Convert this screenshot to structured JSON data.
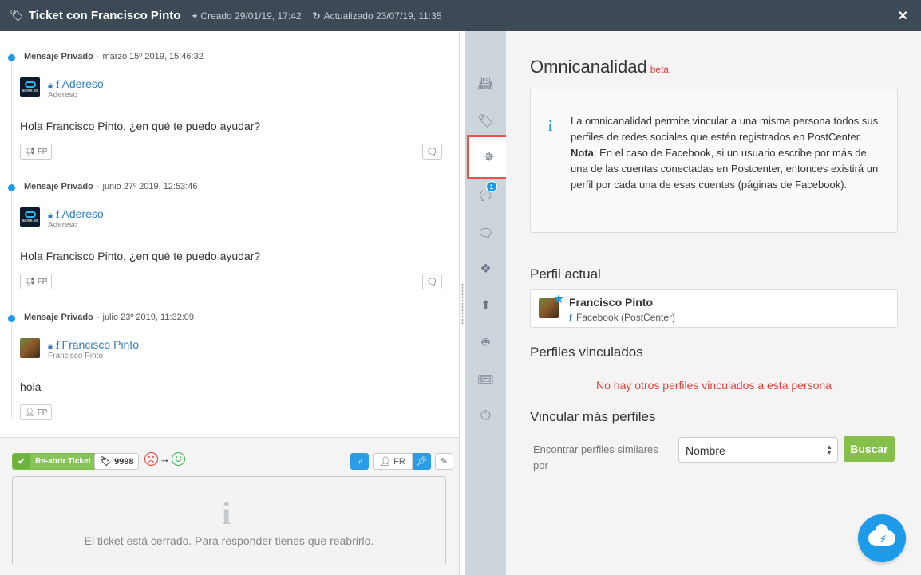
{
  "header": {
    "title": "Ticket con Francisco Pinto",
    "created": "Creado 29/01/19, 17:42",
    "updated": "Actualizado 23/07/19, 11:35"
  },
  "messages": [
    {
      "type": "Mensaje Privado",
      "date": "marzo 15º 2019, 15:46:32",
      "user": "Adereso",
      "user_sub": "Adereso",
      "avatar_text": "adere.so",
      "text": "Hola Francisco Pinto, ¿en qué te puedo ayudar?",
      "tag": "FP"
    },
    {
      "type": "Mensaje Privado",
      "date": "junio 27º 2019, 12:53:46",
      "user": "Adereso",
      "user_sub": "Adereso",
      "avatar_text": "adere.so",
      "text": "Hola Francisco Pinto, ¿en qué te puedo ayudar?",
      "tag": "FP"
    },
    {
      "type": "Mensaje Privado",
      "date": "julio 23º 2019, 11:32:09",
      "user": "Francisco Pinto",
      "user_sub": "Francisco Pinto",
      "text": "hola",
      "tag": "FP"
    }
  ],
  "bottom": {
    "reopen_label": "Re-abrir Ticket",
    "ticket_number": "9998",
    "assignee": "FR",
    "closed_message": "El ticket está cerrado. Para responder tienes que reabrirlo."
  },
  "rail": {
    "active": "omnichannel-icon",
    "badge_count": "1"
  },
  "right": {
    "title": "Omnicanalidad",
    "beta": "beta",
    "info_text": "La omnicanalidad permite vincular a una misma persona todos sus perfiles de redes sociales que estén registrados en PostCenter.",
    "note_label": "Nota",
    "note_text": ": En el caso de Facebook, si un usuario escribe por más de una de las cuentas conectadas en Postcenter, entonces existirá un perfil por cada una de esas cuentas (páginas de Facebook).",
    "current_profile_heading": "Perfil actual",
    "profile_name": "Francisco Pinto",
    "profile_network": "Facebook (PostCenter)",
    "linked_heading": "Perfiles vinculados",
    "no_linked": "No hay otros perfiles vinculados a esta persona",
    "link_more_heading": "Vincular más perfiles",
    "find_label": "Encontrar perfiles similares por",
    "select_value": "Nombre",
    "search_button": "Buscar"
  },
  "colors": {
    "header_bg": "#3d4a55",
    "accent_blue": "#1e9be8",
    "green": "#86c04a",
    "red": "#e0403a",
    "rail_bg": "#cdd5dc"
  }
}
